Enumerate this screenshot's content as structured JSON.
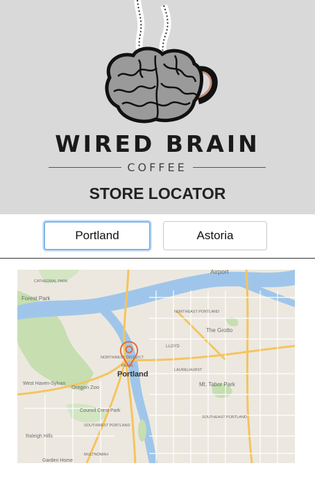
{
  "header": {
    "brand_name": "WIRED BRAIN",
    "brand_sub": "COFFEE",
    "title": "STORE LOCATOR"
  },
  "locations": [
    {
      "label": "Portland",
      "selected": true
    },
    {
      "label": "Astoria",
      "selected": false
    }
  ],
  "map": {
    "city_label": "Portland",
    "labels": [
      "Airport",
      "Forest Park",
      "The Grotto",
      "Mt. Tabor Park",
      "West Haven-Sylvan",
      "Oregon Zoo",
      "Council Crest Park",
      "Raleigh Hills",
      "Garden Home",
      "LLOYD",
      "NORTHWEST DISTRICT",
      "PEARL",
      "LAURELHURST",
      "SOUTHEAST PORTLAND",
      "MULTNOMAH",
      "SOUTHWEST PORTLAND",
      "NORTHEAST PORTLAND",
      "CATHEDRAL PARK"
    ]
  },
  "colors": {
    "header_bg": "#d9d9d9",
    "selected_border": "#7fb3e8",
    "marker": "#e06a3a",
    "river": "#9fc6ea",
    "park": "#c6deb0"
  }
}
